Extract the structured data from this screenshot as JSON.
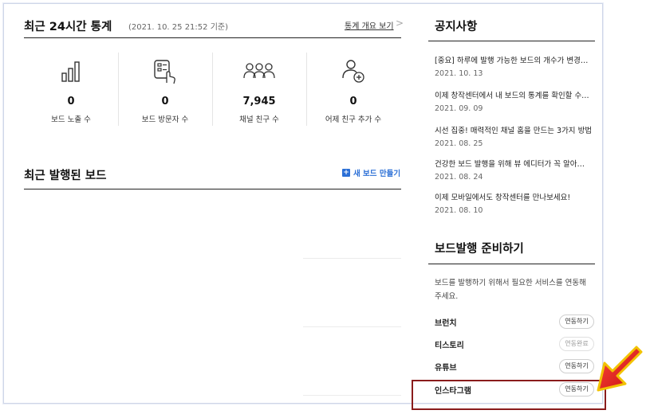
{
  "stats_section": {
    "title": "최근 24시간 통계",
    "basis_date": "(2021. 10. 25 21:52 기준)",
    "overview_link": "통계 개요 보기",
    "overview_chevron": ">",
    "items": [
      {
        "icon": "bar-chart-icon",
        "value": "0",
        "label": "보드 노출 수"
      },
      {
        "icon": "board-tap-icon",
        "value": "0",
        "label": "보드 방문자 수"
      },
      {
        "icon": "people-group-icon",
        "value": "7,945",
        "label": "채널 친구 수"
      },
      {
        "icon": "add-friend-icon",
        "value": "0",
        "label": "어제 친구 추가 수"
      }
    ]
  },
  "recent_boards": {
    "title": "최근 발행된 보드",
    "new_board_label": "새 보드 만들기",
    "plus_glyph": "+"
  },
  "notices": {
    "title": "공지사항",
    "items": [
      {
        "title": "[중요] 하루에 발행 가능한 보드의 개수가 변경…",
        "date": "2021. 10. 13"
      },
      {
        "title": "이제 창작센터에서 내 보드의 통계를 확인할 수…",
        "date": "2021. 09. 09"
      },
      {
        "title": "시선 집중! 매력적인 채널 홈을 만드는 3가지 방법",
        "date": "2021. 08. 25"
      },
      {
        "title": "건강한 보드 발행을 위해 뷰 에디터가 꼭 알아…",
        "date": "2021. 08. 24"
      },
      {
        "title": "이제 모바일에서도 창작센터를 만나보세요!",
        "date": "2021. 08. 10"
      }
    ]
  },
  "prep": {
    "title": "보드발행 준비하기",
    "description": "보드를 발행하기 위해서 필요한 서비스를 연동해 주세요.",
    "services": [
      {
        "name": "브런치",
        "button": "연동하기",
        "state": "link"
      },
      {
        "name": "티스토리",
        "button": "연동완료",
        "state": "done"
      },
      {
        "name": "유튜브",
        "button": "연동하기",
        "state": "link"
      },
      {
        "name": "인스타그램",
        "button": "연동하기",
        "state": "link"
      }
    ]
  },
  "colors": {
    "accent_blue": "#2b6fd6",
    "highlight_border": "#8a1c1c",
    "arrow_red": "#e8151b",
    "arrow_outline": "#f2c200"
  }
}
